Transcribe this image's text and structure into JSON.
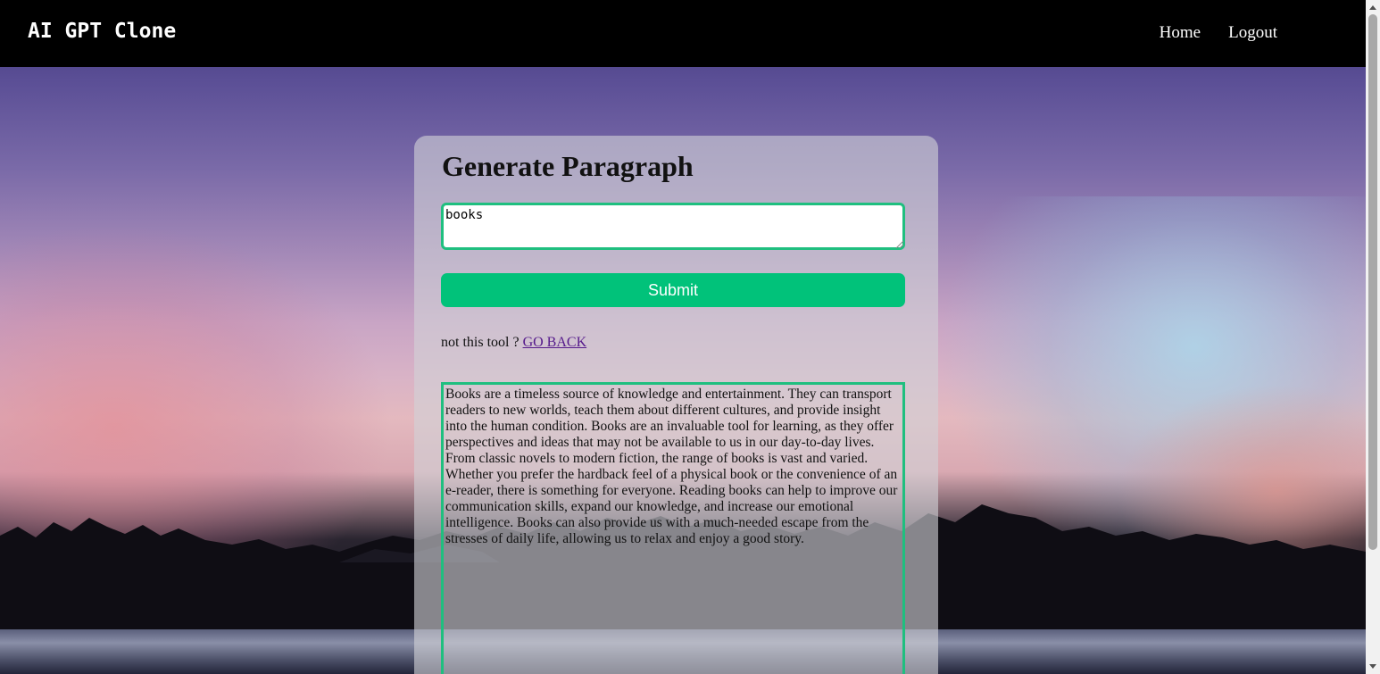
{
  "navbar": {
    "brand": "AI GPT Clone",
    "links": [
      {
        "label": "Home"
      },
      {
        "label": "Logout"
      }
    ]
  },
  "card": {
    "title": "Generate Paragraph",
    "prompt_value": "books",
    "submit_label": "Submit",
    "back_prefix": "not this tool ?",
    "back_link": "GO BACK",
    "result_text": "Books are a timeless source of knowledge and entertainment. They can transport readers to new worlds, teach them about different cultures, and provide insight into the human condition. Books are an invaluable tool for learning, as they offer perspectives and ideas that may not be available to us in our day-to-day lives. From classic novels to modern fiction, the range of books is vast and varied. Whether you prefer the hardback feel of a physical book or the convenience of an e-reader, there is something for everyone. Reading books can help to improve our communication skills, expand our knowledge, and increase our emotional intelligence. Books can also provide us with a much-needed escape from the stresses of daily life, allowing us to relax and enjoy a good story."
  },
  "colors": {
    "accent": "#01c27a",
    "border": "#1fbf7f",
    "navbar": "#000000",
    "link_visited": "#551a8b"
  }
}
